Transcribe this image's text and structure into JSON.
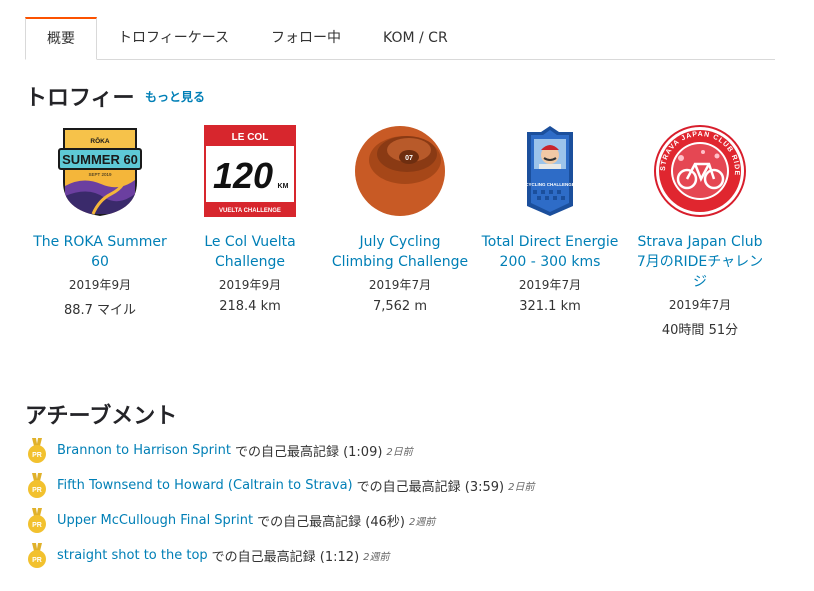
{
  "tabs": [
    {
      "label": "概要"
    },
    {
      "label": "トロフィーケース"
    },
    {
      "label": "フォロー中"
    },
    {
      "label": "KOM / CR"
    }
  ],
  "trophies_section": {
    "title": "トロフィー",
    "see_more": "もっと見る",
    "items": [
      {
        "name": "The ROKA Summer 60",
        "date": "2019年9月",
        "value": "88.7 マイル",
        "badge_text": "SUMMER 60",
        "badge_brand": "RŌKA",
        "badge_sub": "SEPT 2019"
      },
      {
        "name": "Le Col Vuelta Challenge",
        "date": "2019年9月",
        "value": "218.4 km",
        "badge_brand": "LE COL",
        "badge_big": "120",
        "badge_unit": "KM",
        "badge_sub": "VUELTA CHALLENGE"
      },
      {
        "name": "July Cycling Climbing Challenge",
        "date": "2019年7月",
        "value": "7,562 m",
        "badge_num": "07"
      },
      {
        "name": "Total Direct Energie 200 - 300 kms",
        "date": "2019年7月",
        "value": "321.1 km",
        "badge_sub": "CYCLING CHALLENGE"
      },
      {
        "name": "Strava Japan Club 7月のRIDEチャレンジ",
        "date": "2019年7月",
        "value": "40時間 51分",
        "badge_ring": "STRAVA JAPAN CLUB RIDE"
      }
    ]
  },
  "achievements_section": {
    "title": "アチーブメント",
    "medal_label": "PR",
    "items": [
      {
        "segment": "Brannon to Harrison Sprint",
        "text": "での自己最高記録 (1:09)",
        "time": "2日前"
      },
      {
        "segment": "Fifth Townsend to Howard (Caltrain to Strava)",
        "text": "での自己最高記録 (3:59)",
        "time": "2日前"
      },
      {
        "segment": "Upper McCullough Final Sprint",
        "text": "での自己最高記録 (46秒)",
        "time": "2週前"
      },
      {
        "segment": "straight shot to the top",
        "text": "での自己最高記録 (1:12)",
        "time": "2週前"
      }
    ]
  },
  "colors": {
    "accent": "#fc5200",
    "link": "#007fb6",
    "medal_gold": "#f2c12e"
  }
}
